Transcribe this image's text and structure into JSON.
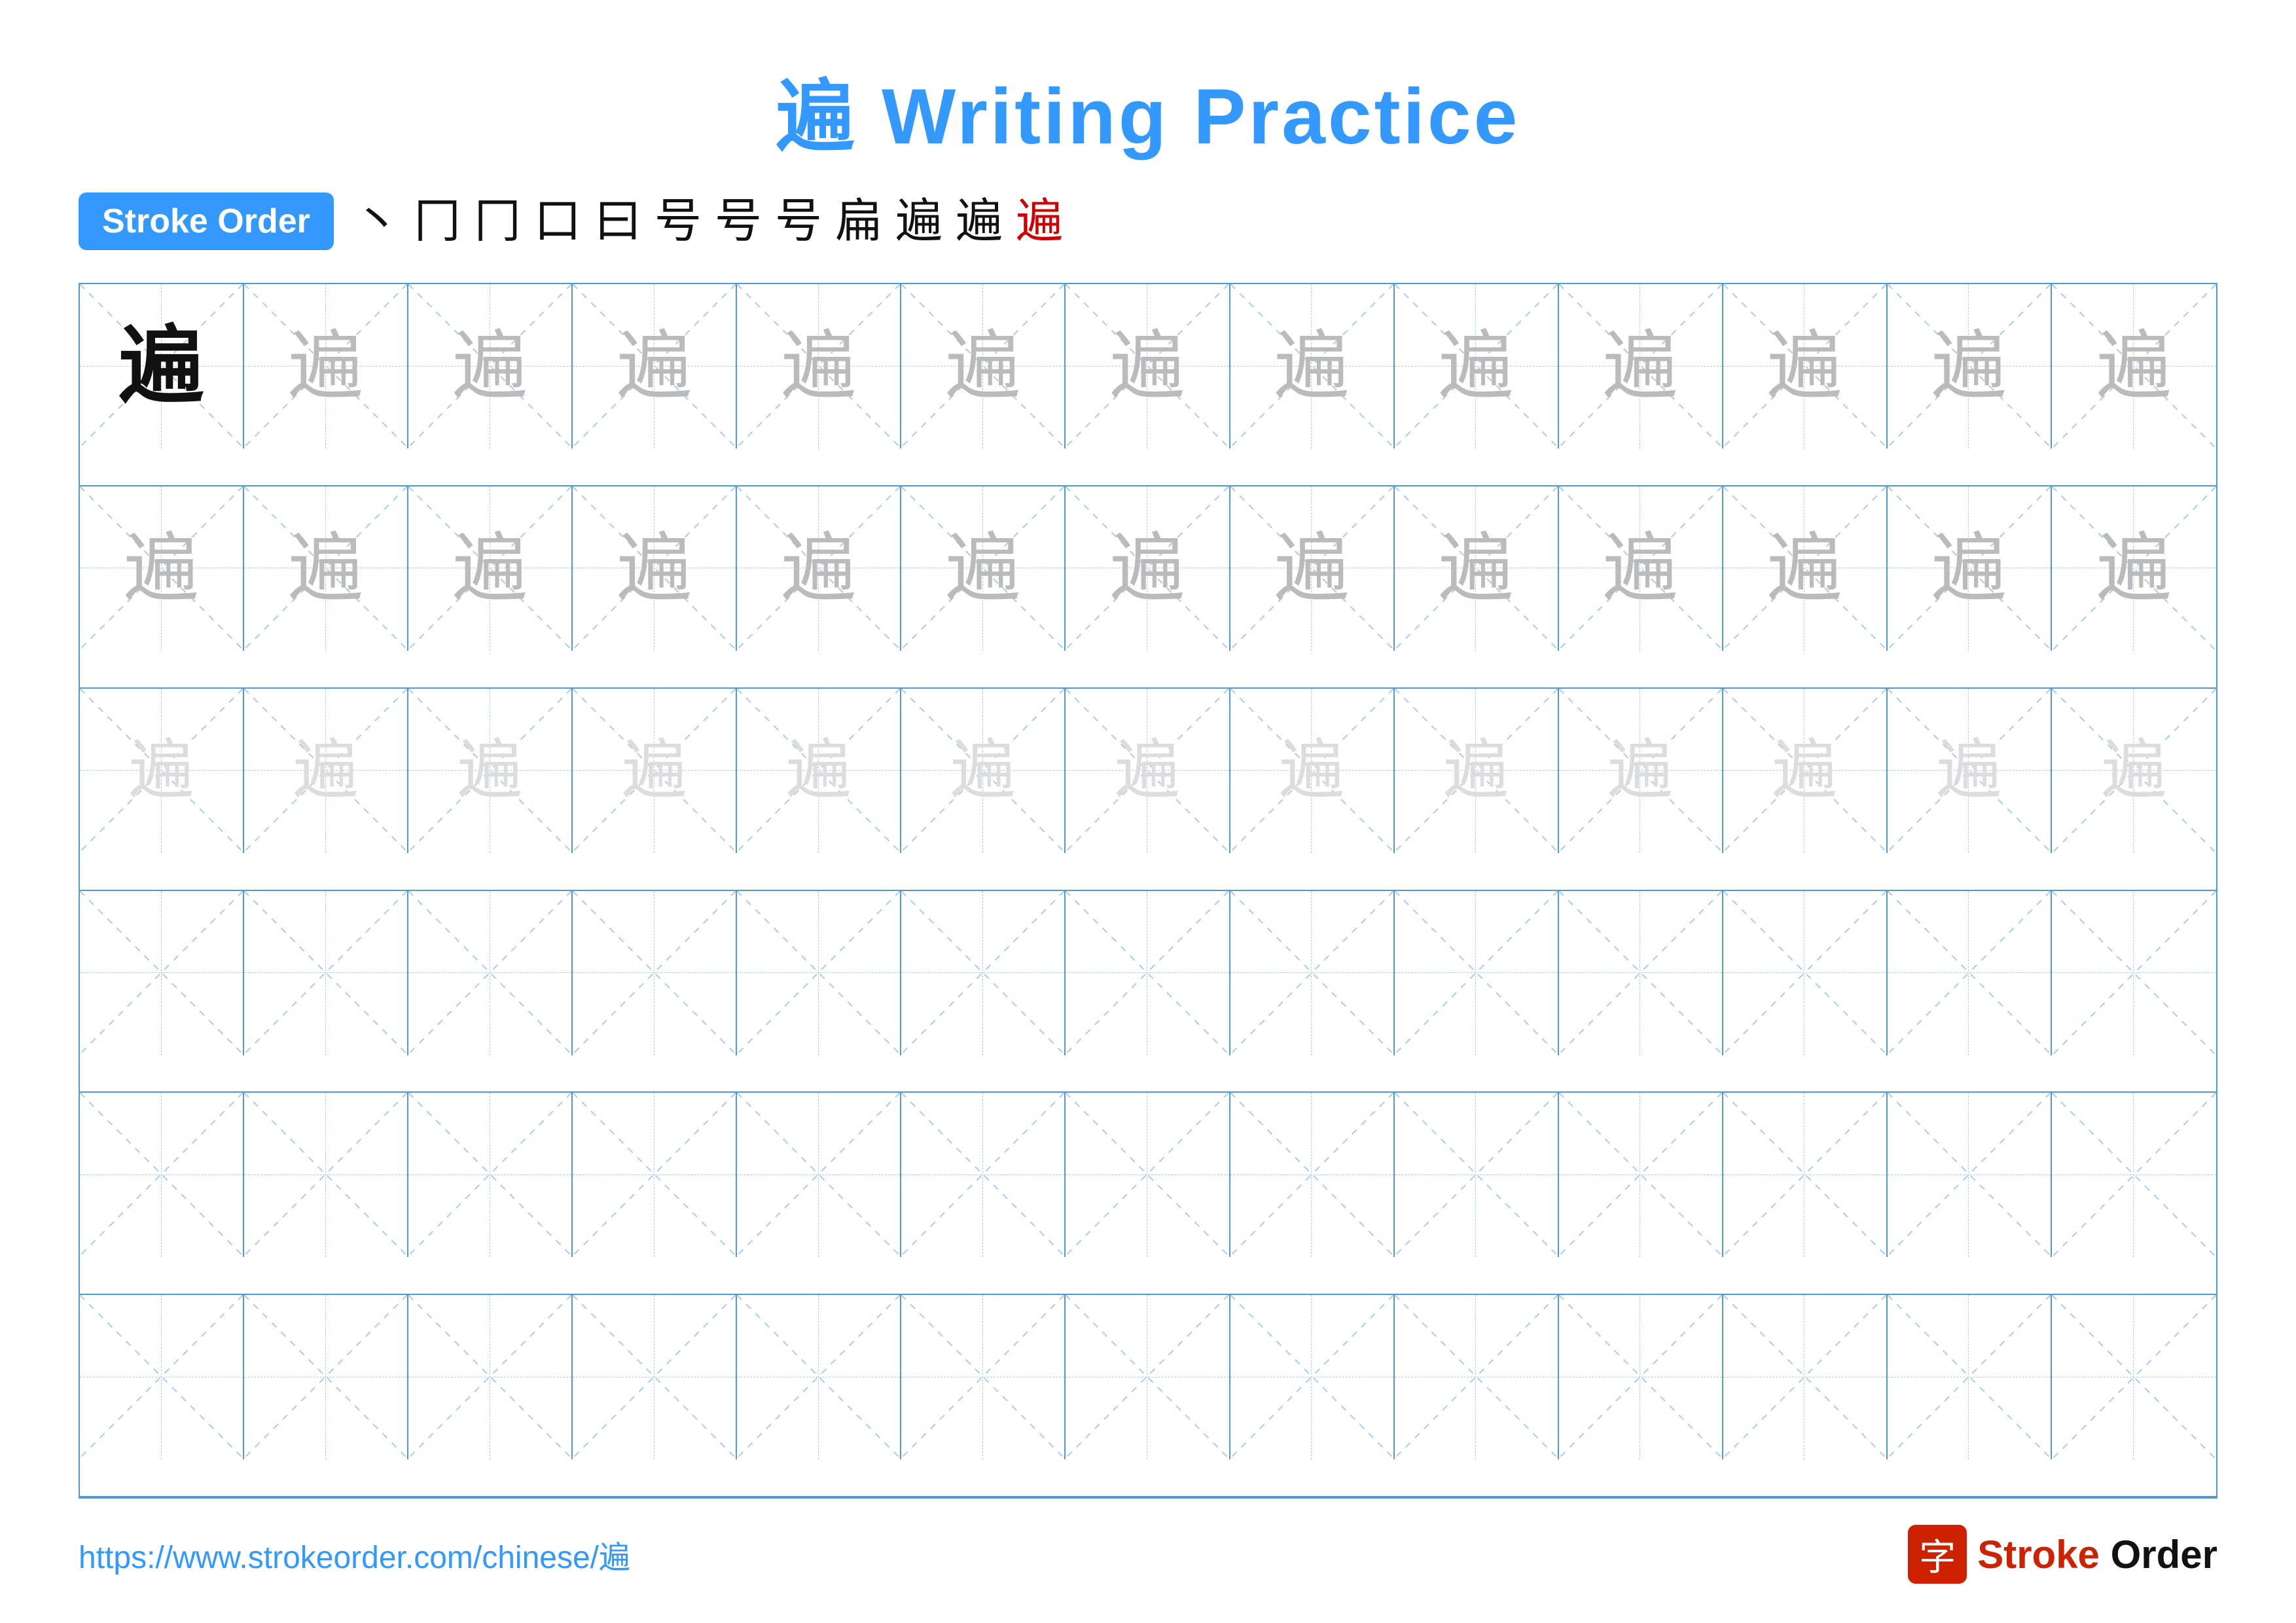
{
  "title": {
    "character": "遍",
    "text": "Writing Practice",
    "full": "遍 Writing Practice"
  },
  "stroke_order": {
    "badge_label": "Stroke Order",
    "strokes": [
      "丶",
      "冂",
      "冂",
      "口",
      "曰",
      "号",
      "号",
      "号",
      "扁",
      "遍",
      "遍",
      "遍"
    ]
  },
  "grid": {
    "rows": 6,
    "cols": 13,
    "character": "遍",
    "row_types": [
      "dark_then_medium",
      "all_medium",
      "all_light",
      "empty",
      "empty",
      "empty"
    ]
  },
  "footer": {
    "url": "https://www.strokeorder.com/chinese/遍",
    "logo_char": "字",
    "logo_text_stroke": "Stroke",
    "logo_text_order": "Order"
  },
  "colors": {
    "blue": "#3399ff",
    "red": "#cc2200",
    "grid_border": "#5599cc",
    "dashed": "#aaccee",
    "dark_char": "#111111",
    "medium_char": "#bbbbbb",
    "light_char": "#dddddd"
  }
}
